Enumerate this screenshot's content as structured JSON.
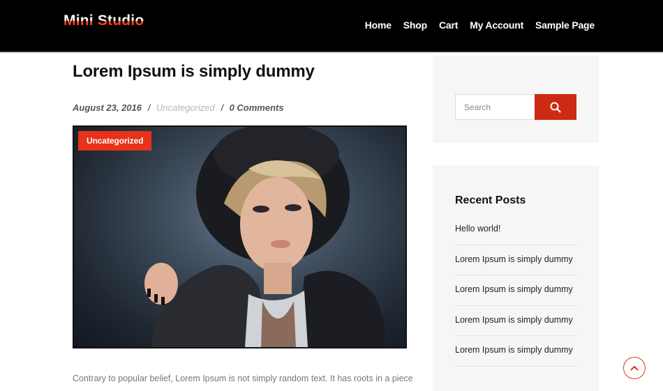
{
  "site": {
    "brand": "Mini Studio"
  },
  "nav": {
    "items": [
      {
        "label": "Home"
      },
      {
        "label": "Shop"
      },
      {
        "label": "Cart"
      },
      {
        "label": "My Account"
      },
      {
        "label": "Sample Page"
      }
    ]
  },
  "post": {
    "title": "Lorem Ipsum is simply dummy",
    "date": "August 23, 2016",
    "category": "Uncategorized",
    "comments": "0 Comments",
    "meta_separator": "/",
    "badge": "Uncategorized",
    "excerpt": "Contrary to popular belief, Lorem Ipsum is not simply random text. It has roots in a piece"
  },
  "sidebar": {
    "search": {
      "placeholder": "Search"
    },
    "recent": {
      "title": "Recent Posts",
      "items": [
        {
          "label": "Hello world!"
        },
        {
          "label": "Lorem Ipsum is simply dummy"
        },
        {
          "label": "Lorem Ipsum is simply dummy"
        },
        {
          "label": "Lorem Ipsum is simply dummy"
        },
        {
          "label": "Lorem Ipsum is simply dummy"
        }
      ]
    }
  },
  "icons": {
    "search": "search-icon",
    "scroll_top": "chevron-up-icon"
  },
  "colors": {
    "header_bg": "#000000",
    "accent": "#e8321a",
    "sidebar_bg": "#f6f6f6"
  }
}
